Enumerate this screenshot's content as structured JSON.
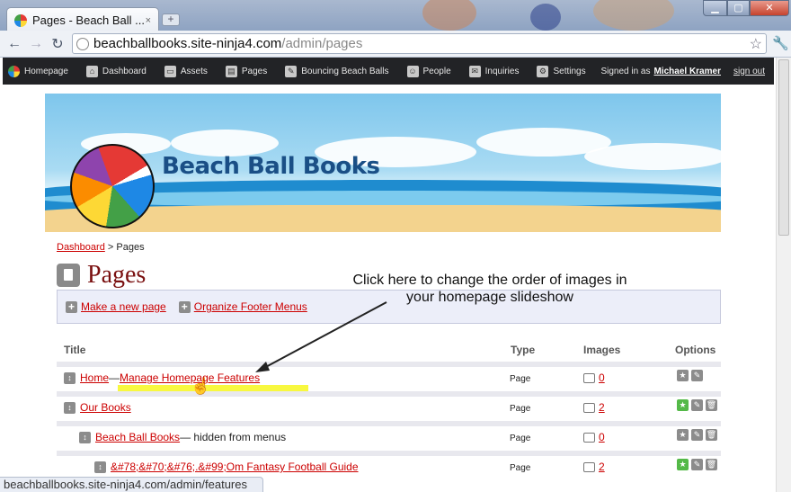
{
  "browser": {
    "tab_title": "Pages - Beach Ball ...",
    "tab_close": "×",
    "new_tab": "+",
    "url_host": "beachballbooks.site-ninja4.com",
    "url_path": "/admin/pages",
    "status_url": "beachballbooks.site-ninja4.com/admin/features"
  },
  "adminbar": {
    "items": [
      {
        "label": "Homepage",
        "icon": "beach-ball-icon"
      },
      {
        "label": "Dashboard",
        "icon": "home-icon"
      },
      {
        "label": "Assets",
        "icon": "folder-icon"
      },
      {
        "label": "Pages",
        "icon": "pages-icon"
      },
      {
        "label": "Bouncing Beach Balls",
        "icon": "pencil-icon"
      },
      {
        "label": "People",
        "icon": "people-icon"
      },
      {
        "label": "Inquiries",
        "icon": "chat-icon"
      },
      {
        "label": "Settings",
        "icon": "gear-icon"
      }
    ],
    "signed_in_prefix": "Signed in as",
    "user_name": "Michael Kramer",
    "sign_out": "sign out"
  },
  "banner": {
    "brand": "Beach Ball Books"
  },
  "breadcrumb": {
    "link": "Dashboard",
    "separator": " > ",
    "current": "Pages"
  },
  "page_title": "Pages",
  "callout": {
    "line1": "Click here to change the order of images in",
    "line2": "your homepage slideshow"
  },
  "actions": {
    "make_page": "Make a new page",
    "organize_footer": "Organize Footer Menus"
  },
  "table": {
    "headers": {
      "title": "Title",
      "type": "Type",
      "images": "Images",
      "options": "Options"
    },
    "rows": [
      {
        "title": "Home",
        "extra_sep": " — ",
        "extra_link": "Manage Homepage Features",
        "type": "Page",
        "images": "0"
      },
      {
        "title": "Our Books",
        "type": "Page",
        "images": "2"
      },
      {
        "title": "Beach Ball Books",
        "note": " — hidden from menus",
        "type": "Page",
        "images": "0"
      },
      {
        "title": "&#78;&#70;&#76;.&#99;Om Fantasy Football Guide",
        "type": "Page",
        "images": "2"
      }
    ]
  },
  "colors": {
    "link": "#cc0000",
    "adminbar": "#222326",
    "highlight": "#f7f71f",
    "title": "#7a1010"
  }
}
